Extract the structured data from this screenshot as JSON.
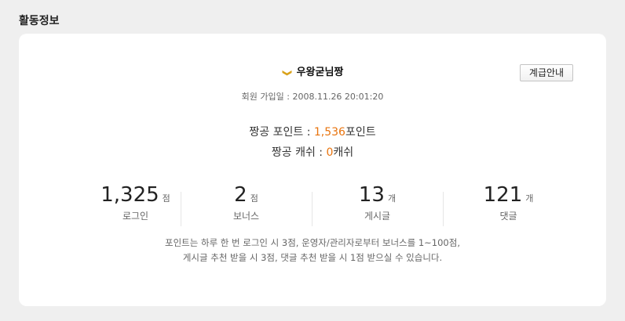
{
  "section": {
    "title": "활동정보"
  },
  "profile": {
    "nickname": "우왕굳님짱",
    "rank_icon": "rank-chevron-icon",
    "joined_label": "회원 가입일 : ",
    "joined_date": "2008.11.26 20:01:20",
    "grade_button_label": "계급안내"
  },
  "points": {
    "label": "짱공 포인트 : ",
    "value": "1,536",
    "unit": "포인트"
  },
  "cash": {
    "label": "짱공 캐쉬 : ",
    "value": "0",
    "unit": "캐쉬"
  },
  "stats": [
    {
      "value": "1,325",
      "unit": "점",
      "label": "로그인"
    },
    {
      "value": "2",
      "unit": "점",
      "label": "보너스"
    },
    {
      "value": "13",
      "unit": "개",
      "label": "게시글"
    },
    {
      "value": "121",
      "unit": "개",
      "label": "댓글"
    }
  ],
  "info": {
    "line1": "포인트는 하루 한 번 로그인 시 3점, 운영자/관리자로부터 보너스를 1~100점,",
    "line2": "게시글 추천 받을 시 3점, 댓글 추천 받을 시 1점 받으실 수 있습니다."
  },
  "colors": {
    "accent": "#e8730d",
    "rank_icon": "#d9a21b"
  }
}
